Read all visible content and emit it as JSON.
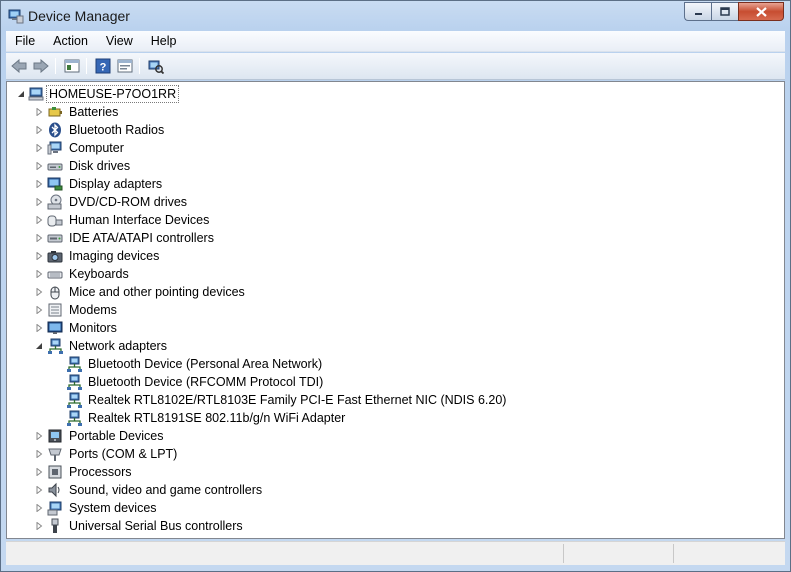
{
  "window": {
    "title": "Device Manager"
  },
  "menubar": {
    "items": [
      "File",
      "Action",
      "View",
      "Help"
    ]
  },
  "toolbar": {
    "buttons": [
      "back-icon",
      "forward-icon",
      "properties-view-icon",
      "help-icon",
      "show-hidden-icon",
      "scan-hardware-icon"
    ]
  },
  "tree": {
    "root": "HOMEUSE-P7OO1RR",
    "categories": [
      {
        "label": "Batteries",
        "icon": "battery-icon"
      },
      {
        "label": "Bluetooth Radios",
        "icon": "bluetooth-icon"
      },
      {
        "label": "Computer",
        "icon": "computer-icon"
      },
      {
        "label": "Disk drives",
        "icon": "disk-drive-icon"
      },
      {
        "label": "Display adapters",
        "icon": "display-adapter-icon"
      },
      {
        "label": "DVD/CD-ROM drives",
        "icon": "dvd-icon"
      },
      {
        "label": "Human Interface Devices",
        "icon": "hid-icon"
      },
      {
        "label": "IDE ATA/ATAPI controllers",
        "icon": "ide-controller-icon"
      },
      {
        "label": "Imaging devices",
        "icon": "imaging-device-icon"
      },
      {
        "label": "Keyboards",
        "icon": "keyboard-icon"
      },
      {
        "label": "Mice and other pointing devices",
        "icon": "mouse-icon"
      },
      {
        "label": "Modems",
        "icon": "modem-icon"
      },
      {
        "label": "Monitors",
        "icon": "monitor-icon"
      },
      {
        "label": "Network adapters",
        "icon": "network-adapter-icon",
        "expanded": true,
        "children": [
          "Bluetooth Device (Personal Area Network)",
          "Bluetooth Device (RFCOMM Protocol TDI)",
          "Realtek RTL8102E/RTL8103E Family PCI-E Fast Ethernet NIC (NDIS 6.20)",
          "Realtek RTL8191SE 802.11b/g/n WiFi Adapter"
        ]
      },
      {
        "label": "Portable Devices",
        "icon": "portable-device-icon"
      },
      {
        "label": "Ports (COM & LPT)",
        "icon": "port-icon"
      },
      {
        "label": "Processors",
        "icon": "processor-icon"
      },
      {
        "label": "Sound, video and game controllers",
        "icon": "sound-icon"
      },
      {
        "label": "System devices",
        "icon": "system-device-icon"
      },
      {
        "label": "Universal Serial Bus controllers",
        "icon": "usb-icon"
      }
    ]
  }
}
